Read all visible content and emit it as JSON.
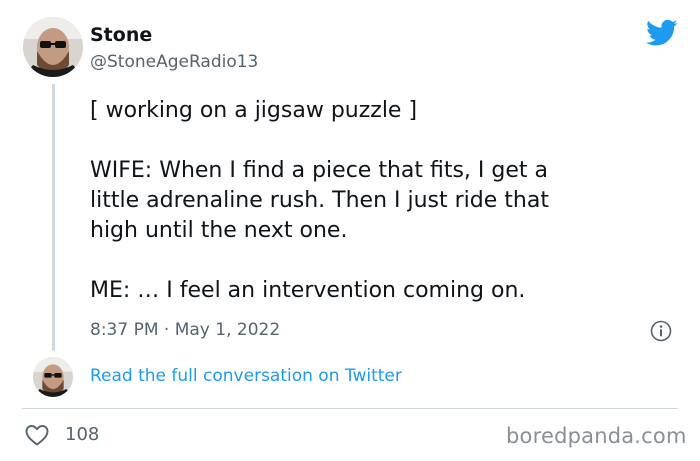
{
  "author": {
    "display_name": "Stone",
    "handle": "@StoneAgeRadio13"
  },
  "tweet": {
    "paragraphs": [
      "[ working on a jigsaw puzzle ]",
      "WIFE: When I find a piece that fits, I get a\nlittle adrenaline rush. Then I just ride that\nhigh until the next one.",
      "ME: … I feel an intervention coming on."
    ],
    "timestamp": "8:37 PM · May 1, 2022"
  },
  "footer": {
    "read_conversation_label": "Read the full conversation on Twitter",
    "like_count": "108"
  },
  "watermark": "boredpanda.com",
  "icons": {
    "brand": "twitter-bird-icon",
    "info": "info-icon",
    "like": "heart-icon"
  },
  "colors": {
    "twitter_blue": "#1d9bf0",
    "secondary_text": "#536471",
    "primary_text": "#0f1419",
    "divider": "#cfd9de"
  }
}
